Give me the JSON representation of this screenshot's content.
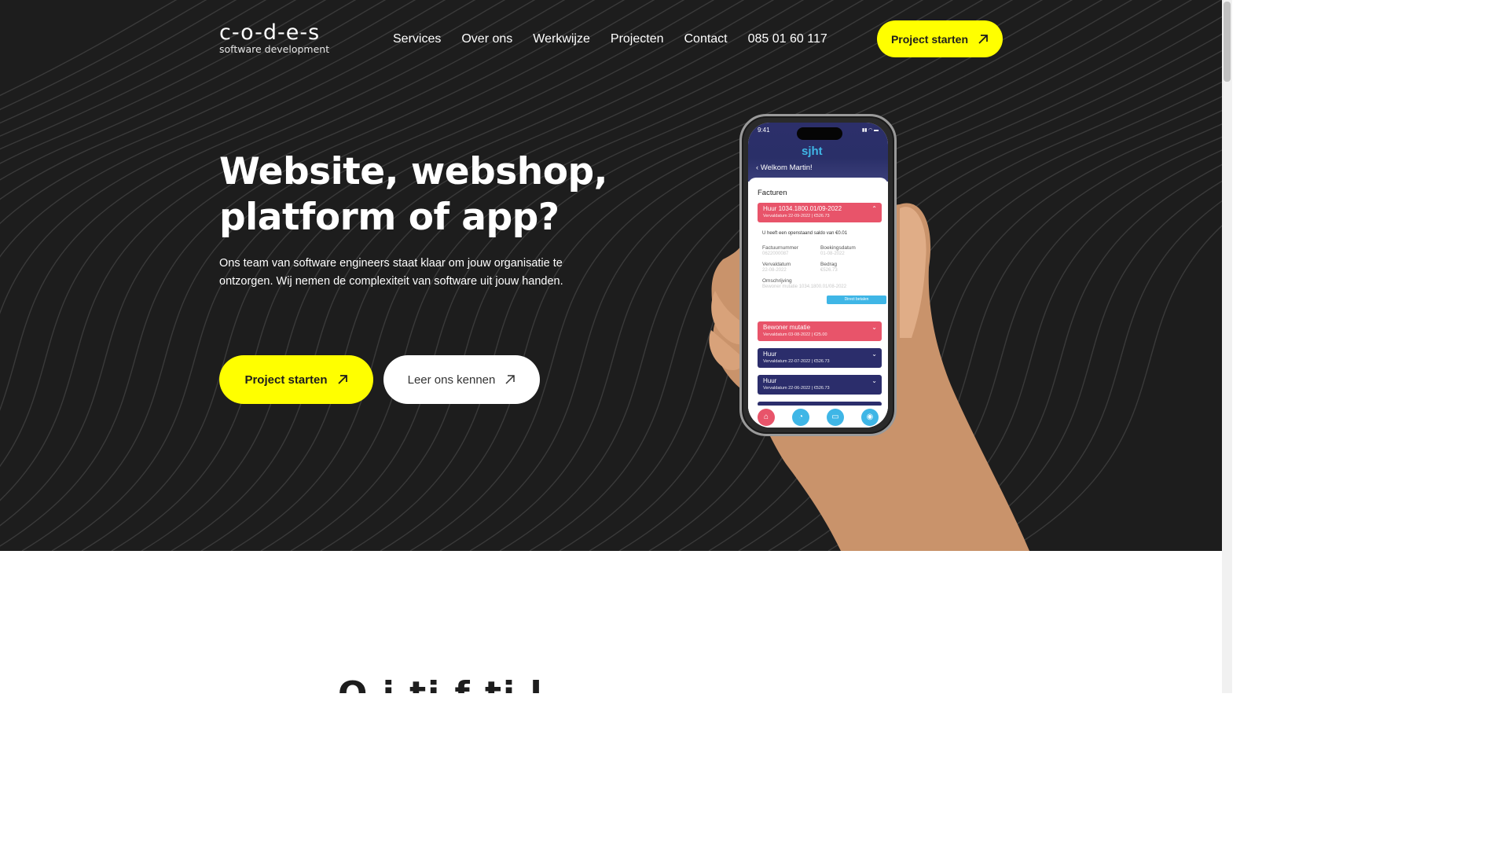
{
  "header": {
    "logo_main": "c-o-d-e-s",
    "logo_sub": "software development",
    "nav": [
      "Services",
      "Over ons",
      "Werkwijze",
      "Projecten",
      "Contact",
      "085 01 60 117"
    ],
    "cta_label": "Project starten"
  },
  "hero": {
    "headline_line1": "Website, webshop,",
    "headline_line2": "platform of app?",
    "subtext": "Ons team van software engineers staat klaar om jouw organisatie te ontzorgen. Wij nemen de complexiteit van software uit jouw handen.",
    "primary_button": "Project starten",
    "secondary_button": "Leer ons kennen"
  },
  "phone_app": {
    "time": "9:41",
    "brand": "sjht",
    "welcome": "Welkom Martin!",
    "section_title": "Facturen",
    "invoices": [
      {
        "title": "Huur 1034.1800.01/09-2022",
        "sub": "Vervaldatum 22-09-2022 | €526.73",
        "status": "open"
      },
      {
        "title": "Bewoner mutatie",
        "sub": "Vervaldatum 03-08-2022 | €25.00",
        "status": "open"
      },
      {
        "title": "Huur",
        "sub": "Vervaldatum 22-07-2022 | €526.73",
        "status": "paid"
      },
      {
        "title": "Huur",
        "sub": "Vervaldatum 22-06-2022 | €526.73",
        "status": "paid"
      }
    ],
    "detail": {
      "message": "U heeft een openstaand saldo van €0.01",
      "factuurnummer_label": "Factuurnummer",
      "factuurnummer_value": "0622000087",
      "boekingsdatum_label": "Boekingsdatum",
      "boekingsdatum_value": "01-08-2022",
      "vervaldatum_label": "Vervaldatum",
      "vervaldatum_value": "22-08-2022",
      "bedrag_label": "Bedrag",
      "bedrag_value": "€526.73",
      "omschrijving_label": "Omschrijving",
      "omschrijving_value": "Bewoner mutatie 1034.1800.01/08-2022",
      "pay_button": "Direct betalen"
    }
  },
  "next_section": {
    "heading_partial": "O                 i                    ti  f    ti      l"
  },
  "colors": {
    "hero_bg": "#1d1d1d",
    "accent_yellow": "#ffff00",
    "logo_dash": "#d8e84a",
    "app_red": "#e8546a",
    "app_navy": "#2b2d6b",
    "app_blue": "#3fb6e6"
  }
}
